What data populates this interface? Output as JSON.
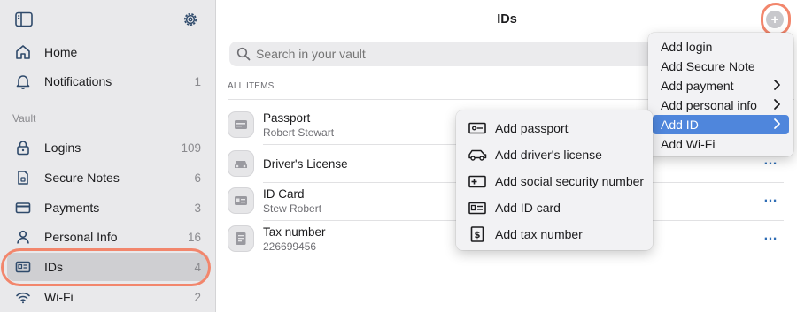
{
  "sidebar": {
    "nav": [
      {
        "label": "Home",
        "count": "",
        "icon": "home-icon"
      },
      {
        "label": "Notifications",
        "count": "1",
        "icon": "bell-icon"
      }
    ],
    "section_title": "Vault",
    "vault_items": [
      {
        "label": "Logins",
        "count": "109",
        "icon": "lock-icon"
      },
      {
        "label": "Secure Notes",
        "count": "6",
        "icon": "note-icon"
      },
      {
        "label": "Payments",
        "count": "3",
        "icon": "card-icon"
      },
      {
        "label": "Personal Info",
        "count": "16",
        "icon": "person-icon"
      },
      {
        "label": "IDs",
        "count": "4",
        "icon": "id-icon"
      },
      {
        "label": "Wi-Fi",
        "count": "2",
        "icon": "wifi-icon"
      }
    ]
  },
  "main": {
    "title": "IDs",
    "search_placeholder": "Search in your vault",
    "section_label": "ALL ITEMS",
    "items": [
      {
        "title": "Passport",
        "subtitle": "Robert Stewart"
      },
      {
        "title": "Driver's License",
        "subtitle": ""
      },
      {
        "title": "ID Card",
        "subtitle": "Stew Robert"
      },
      {
        "title": "Tax number",
        "subtitle": "226699456"
      }
    ],
    "more_label": "…"
  },
  "add_menu": {
    "items": [
      "Add login",
      "Add Secure Note",
      "Add payment",
      "Add personal info",
      "Add ID",
      "Add Wi-Fi"
    ],
    "selected": "Add ID"
  },
  "id_submenu": {
    "items": [
      "Add passport",
      "Add driver's license",
      "Add social security number",
      "Add ID card",
      "Add tax number"
    ]
  },
  "colors": {
    "accent": "#4f86dc",
    "highlight_ring": "#f2866c",
    "link": "#2f6db5"
  }
}
